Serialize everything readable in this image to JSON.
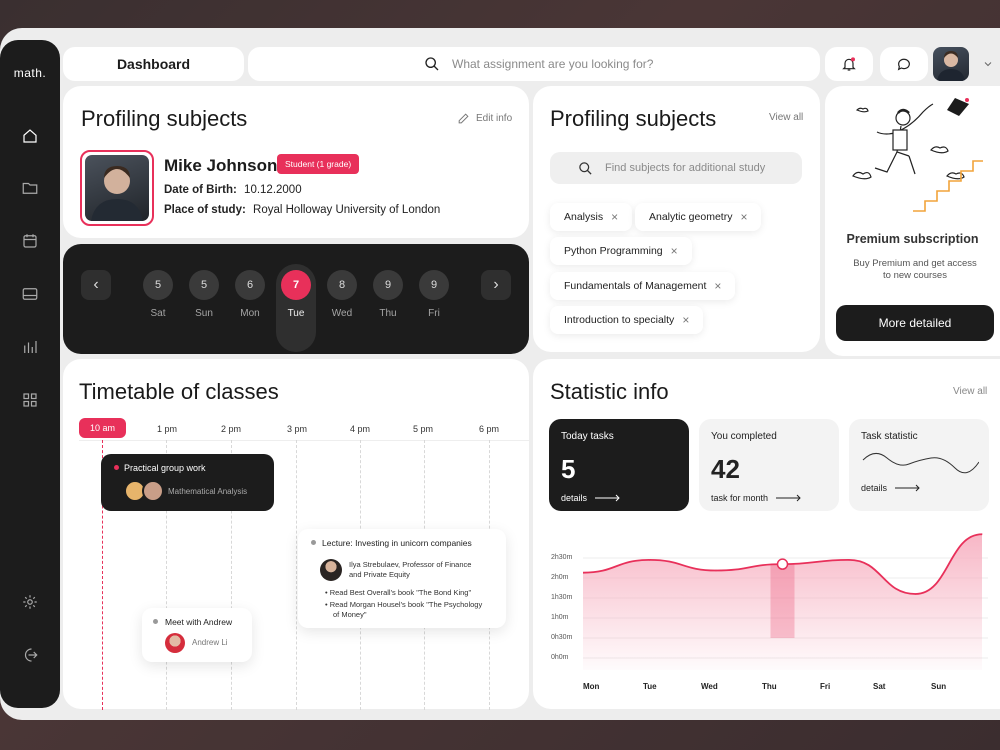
{
  "app": {
    "logo": "math."
  },
  "header": {
    "title": "Dashboard",
    "search_placeholder": "What assignment are you looking for?"
  },
  "profile": {
    "title": "Profiling subjects",
    "edit_label": "Edit info",
    "name": "Mike Johnson",
    "badge": "Student (1 grade)",
    "dob_label": "Date of Birth:",
    "dob": "10.12.2000",
    "place_label": "Place of study:",
    "place": "Royal Holloway University of London"
  },
  "calendar": {
    "days": [
      {
        "num": "5",
        "label": "Sat"
      },
      {
        "num": "5",
        "label": "Sun"
      },
      {
        "num": "6",
        "label": "Mon"
      },
      {
        "num": "7",
        "label": "Tue",
        "active": true
      },
      {
        "num": "8",
        "label": "Wed"
      },
      {
        "num": "9",
        "label": "Thu"
      },
      {
        "num": "9",
        "label": "Fri"
      }
    ],
    "prev": "‹",
    "next": "›"
  },
  "subjects": {
    "title": "Profiling subjects",
    "view_all": "View all",
    "search_placeholder": "Find subjects for additional study",
    "tags": [
      "Analysis",
      "Analytic geometry",
      "Python Programming",
      "Fundamentals of Management",
      "Introduction to specialty"
    ],
    "remove_symbol": "×"
  },
  "premium": {
    "title": "Premium subscription",
    "text1": "Buy Premium and get access",
    "text2": "to new courses",
    "button": "More detailed"
  },
  "timetable": {
    "title": "Timetable of classes",
    "hours": [
      "10 am",
      "1 pm",
      "2 pm",
      "3 pm",
      "4 pm",
      "5 pm",
      "6 pm"
    ],
    "event1": {
      "title": "Practical group work",
      "subtitle": "Mathematical Analysis"
    },
    "event2": {
      "title": "Lecture: Investing in unicorn companies",
      "person1": "Ilya Strebulaev, Professor of Finance",
      "person2": "and Private Equity",
      "b1": "Read Best Overall's book \"The Bond King\"",
      "b2a": "Read Morgan Housel's book \"The Psychology",
      "b2b": "of Money\""
    },
    "event3": {
      "title": "Meet with Andrew",
      "person": "Andrew Li"
    }
  },
  "statistic": {
    "title": "Statistic info",
    "view_all": "View all",
    "cards": [
      {
        "title": "Today tasks",
        "value": "5",
        "link": "details"
      },
      {
        "title": "You completed",
        "value": "42",
        "link": "task for month"
      },
      {
        "title": "Task statistic",
        "link": "details"
      }
    ]
  },
  "chart_data": {
    "type": "area",
    "categories": [
      "Mon",
      "Tue",
      "Wed",
      "Thu",
      "Fri",
      "Sat",
      "Sun"
    ],
    "y_ticks": [
      "2h30m",
      "2h0m",
      "1h30m",
      "1h0m",
      "0h30m",
      "0h0m"
    ],
    "values": [
      2.0,
      2.3,
      2.05,
      2.2,
      2.3,
      1.5,
      2.9
    ],
    "ylim": [
      0,
      3
    ],
    "highlight": "Thu",
    "colors": {
      "line": "#e8305a",
      "fill": "#f7b3c3"
    }
  }
}
